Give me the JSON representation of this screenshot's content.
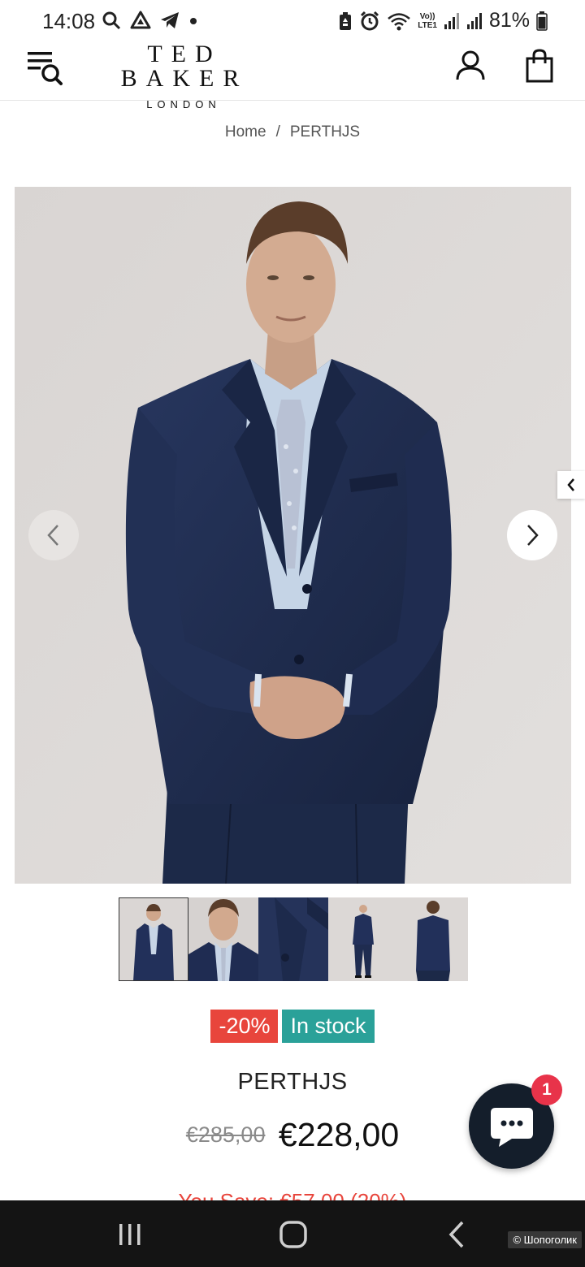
{
  "status_bar": {
    "time": "14:08",
    "network_line1": "Vo))",
    "network_line2": "LTE1",
    "battery_percent": "81%",
    "battery_level": 0.81
  },
  "header": {
    "brand_name": "TED BAKER",
    "brand_sub": "LONDON",
    "icons": [
      "menu-search-icon",
      "user-icon",
      "shopping-bag-icon"
    ]
  },
  "breadcrumb": {
    "home": "Home",
    "separator": "/",
    "current": "PERTHJS"
  },
  "gallery": {
    "thumbnail_count": 5,
    "active_index": 0
  },
  "badges": {
    "discount": "-20%",
    "stock": "In stock"
  },
  "product": {
    "title": "PERTHJS",
    "price_old": "€285,00",
    "price_new": "€228,00",
    "savings": "You Save: €57,00 (20%)"
  },
  "chat": {
    "badge_count": "1"
  },
  "watermark": "© Шопоголик",
  "colors": {
    "sale": "#e8453c",
    "stock": "#2aa199",
    "chat": "#141e2b",
    "chat_badge": "#e8334a",
    "suit": "#1f2d52"
  }
}
